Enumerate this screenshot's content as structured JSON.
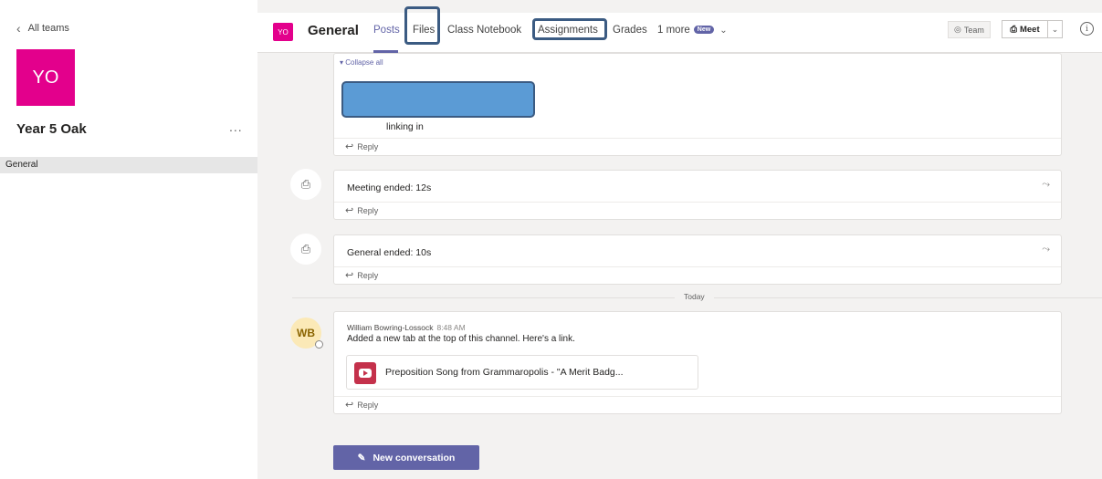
{
  "sidebar": {
    "back_label": "All teams",
    "team_initials": "YO",
    "team_name": "Year 5 Oak",
    "more_label": "...",
    "channels": [
      {
        "label": "General"
      }
    ]
  },
  "header": {
    "channel_initials": "YO",
    "channel_name": "General",
    "tabs": [
      {
        "label": "Posts"
      },
      {
        "label": "Files"
      },
      {
        "label": "Class Notebook"
      },
      {
        "label": "Assignments"
      },
      {
        "label": "Grades"
      },
      {
        "label": "1 more"
      }
    ],
    "new_badge": "New",
    "team_button": "Team",
    "meet_button": "Meet"
  },
  "feed": {
    "collapse_label": "Collapse all",
    "linking_text": "linking in",
    "reply_label": "Reply",
    "meeting1": "Meeting ended: 12s",
    "meeting2": "General ended: 10s",
    "divider_label": "Today",
    "post": {
      "author_initials": "WB",
      "author": "William Bowring-Lossock",
      "time": "8:48 AM",
      "body": "Added a new tab at the top of this channel. Here's a link.",
      "link_title": "Preposition Song from Grammaropolis - \"A Merit Badg..."
    },
    "new_conversation": "New conversation"
  },
  "colors": {
    "brand": "#6264a7",
    "team_color": "#e3008c",
    "highlight_border": "#3b5b82"
  }
}
